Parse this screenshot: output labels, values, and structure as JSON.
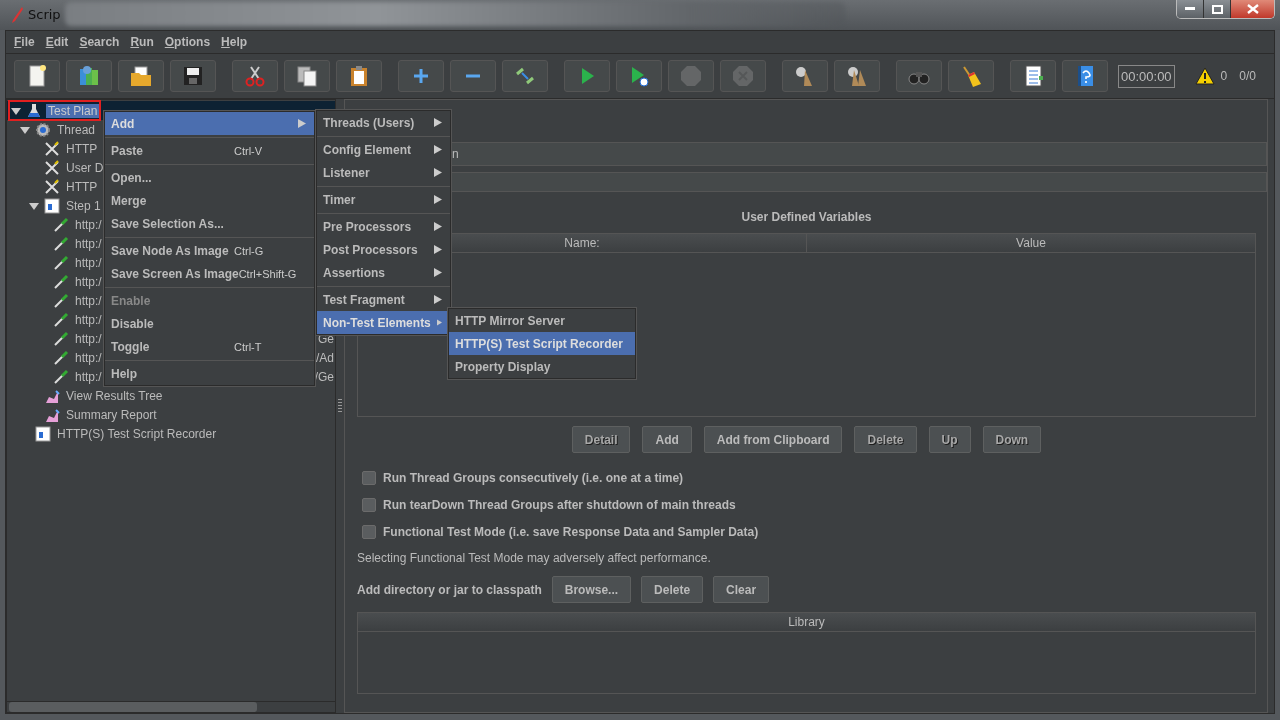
{
  "window": {
    "title": "Scrip"
  },
  "menu_bar": [
    "File",
    "Edit",
    "Search",
    "Run",
    "Options",
    "Help"
  ],
  "toolbar": {
    "groups": [
      [
        {
          "kind": "new",
          "disabled": false
        },
        {
          "kind": "templates",
          "disabled": false
        },
        {
          "kind": "open",
          "disabled": false
        },
        {
          "kind": "save",
          "disabled": false
        }
      ],
      [
        {
          "kind": "cut",
          "disabled": false
        },
        {
          "kind": "copy",
          "disabled": false
        },
        {
          "kind": "paste",
          "disabled": false
        }
      ],
      [
        {
          "kind": "expand",
          "disabled": false
        },
        {
          "kind": "collapse",
          "disabled": false
        },
        {
          "kind": "toggle",
          "disabled": false
        }
      ],
      [
        {
          "kind": "start",
          "disabled": false
        },
        {
          "kind": "start-no-pause",
          "disabled": false
        },
        {
          "kind": "stop",
          "disabled": true
        },
        {
          "kind": "shutdown",
          "disabled": true
        }
      ],
      [
        {
          "kind": "clear",
          "disabled": false
        },
        {
          "kind": "clear-all",
          "disabled": false
        }
      ],
      [
        {
          "kind": "search",
          "disabled": false
        },
        {
          "kind": "reset-search",
          "disabled": false
        }
      ],
      [
        {
          "kind": "functions",
          "disabled": false
        },
        {
          "kind": "help",
          "disabled": false
        }
      ]
    ],
    "timer": "00:00:00",
    "warnings": "0",
    "threads": "0/0"
  },
  "tree": {
    "items": [
      {
        "label": "Test Plan",
        "kind": "test-plan",
        "selected": true,
        "expanded": true,
        "children": [
          {
            "label": "Thread",
            "kind": "thread-group",
            "selected": false,
            "expanded": true,
            "children": [
              {
                "label": "HTTP",
                "kind": "config",
                "selected": false
              },
              {
                "label": "User D",
                "kind": "config",
                "selected": false
              },
              {
                "label": "HTTP",
                "kind": "config",
                "selected": false
              },
              {
                "label": "Step 1",
                "kind": "controller",
                "selected": false,
                "expanded": true,
                "children": [
                  {
                    "label": "http:/",
                    "kind": "sampler",
                    "selected": false
                  },
                  {
                    "label": "http:/",
                    "kind": "sampler",
                    "selected": false
                  },
                  {
                    "label": "http:/",
                    "kind": "sampler",
                    "selected": false
                  },
                  {
                    "label": "http:/",
                    "kind": "sampler",
                    "selected": false
                  },
                  {
                    "label": "http:/",
                    "kind": "sampler",
                    "selected": false
                  },
                  {
                    "label": "http:/",
                    "kind": "sampler",
                    "selected": false
                  },
                  {
                    "label": "http:/",
                    "kind": "sampler",
                    "selected": false,
                    "tail": "Ge"
                  },
                  {
                    "label": "http:/",
                    "kind": "sampler",
                    "selected": false,
                    "tail": "/Ad"
                  },
                  {
                    "label": "http:/",
                    "kind": "sampler",
                    "selected": false,
                    "tail": "/Ge"
                  }
                ]
              },
              {
                "label": "View Results Tree",
                "kind": "listener",
                "selected": false
              },
              {
                "label": "Summary Report",
                "kind": "listener",
                "selected": false
              }
            ]
          },
          {
            "label": "HTTP(S) Test Script Recorder",
            "kind": "recorder",
            "selected": false
          }
        ]
      }
    ]
  },
  "editor": {
    "name_field": {
      "value": "n"
    },
    "variables": {
      "title": "User Defined Variables",
      "columns": [
        "Name:",
        "Value"
      ]
    },
    "table_buttons": [
      {
        "label": "Detail",
        "disabled": true
      },
      {
        "label": "Add",
        "disabled": false
      },
      {
        "label": "Add from Clipboard",
        "disabled": false
      },
      {
        "label": "Delete",
        "disabled": true
      },
      {
        "label": "Up",
        "disabled": true
      },
      {
        "label": "Down",
        "disabled": true
      }
    ],
    "options": [
      {
        "label": "Run Thread Groups consecutively (i.e. one at a time)",
        "checked": false
      },
      {
        "label": "Run tearDown Thread Groups after shutdown of main threads",
        "checked": false
      },
      {
        "label": "Functional Test Mode (i.e. save Response Data and Sampler Data)",
        "checked": false
      }
    ],
    "note": "Selecting Functional Test Mode may adversely affect performance.",
    "classpath": {
      "label": "Add directory or jar to classpath",
      "buttons": [
        {
          "label": "Browse...",
          "disabled": false
        },
        {
          "label": "Delete",
          "disabled": false
        },
        {
          "label": "Clear",
          "disabled": false
        }
      ]
    },
    "library": {
      "columns": [
        "Library"
      ]
    }
  },
  "context_menu": {
    "items": [
      {
        "kind": "item",
        "label": "Add",
        "has_submenu": true,
        "selected": true,
        "disabled": false
      },
      {
        "kind": "separator"
      },
      {
        "kind": "item",
        "label": "Paste",
        "shortcut": "Ctrl-V",
        "has_submenu": false,
        "selected": false,
        "disabled": false
      },
      {
        "kind": "separator"
      },
      {
        "kind": "item",
        "label": "Open...",
        "has_submenu": false,
        "selected": false,
        "disabled": false
      },
      {
        "kind": "item",
        "label": "Merge",
        "has_submenu": false,
        "selected": false,
        "disabled": false
      },
      {
        "kind": "item",
        "label": "Save Selection As...",
        "has_submenu": false,
        "selected": false,
        "disabled": false
      },
      {
        "kind": "separator"
      },
      {
        "kind": "item",
        "label": "Save Node As Image",
        "shortcut": "Ctrl-G",
        "has_submenu": false,
        "selected": false,
        "disabled": false
      },
      {
        "kind": "item",
        "label": "Save Screen As Image",
        "shortcut": "Ctrl+Shift-G",
        "has_submenu": false,
        "selected": false,
        "disabled": false
      },
      {
        "kind": "separator"
      },
      {
        "kind": "item",
        "label": "Enable",
        "has_submenu": false,
        "selected": false,
        "disabled": true
      },
      {
        "kind": "item",
        "label": "Disable",
        "has_submenu": false,
        "selected": false,
        "disabled": false
      },
      {
        "kind": "item",
        "label": "Toggle",
        "shortcut": "Ctrl-T",
        "has_submenu": false,
        "selected": false,
        "disabled": false
      },
      {
        "kind": "separator"
      },
      {
        "kind": "item",
        "label": "Help",
        "has_submenu": false,
        "selected": false,
        "disabled": false
      }
    ]
  },
  "add_submenu": {
    "items": [
      {
        "kind": "item",
        "label": "Threads (Users)",
        "has_submenu": true,
        "selected": false,
        "disabled": false
      },
      {
        "kind": "separator"
      },
      {
        "kind": "item",
        "label": "Config Element",
        "has_submenu": true,
        "selected": false,
        "disabled": false
      },
      {
        "kind": "item",
        "label": "Listener",
        "has_submenu": true,
        "selected": false,
        "disabled": false
      },
      {
        "kind": "separator"
      },
      {
        "kind": "item",
        "label": "Timer",
        "has_submenu": true,
        "selected": false,
        "disabled": false
      },
      {
        "kind": "separator"
      },
      {
        "kind": "item",
        "label": "Pre Processors",
        "has_submenu": true,
        "selected": false,
        "disabled": false
      },
      {
        "kind": "item",
        "label": "Post Processors",
        "has_submenu": true,
        "selected": false,
        "disabled": false
      },
      {
        "kind": "item",
        "label": "Assertions",
        "has_submenu": true,
        "selected": false,
        "disabled": false
      },
      {
        "kind": "separator"
      },
      {
        "kind": "item",
        "label": "Test Fragment",
        "has_submenu": true,
        "selected": false,
        "disabled": false
      },
      {
        "kind": "item",
        "label": "Non-Test Elements",
        "has_submenu": true,
        "selected": true,
        "disabled": false
      }
    ]
  },
  "non_test_submenu": {
    "items": [
      {
        "kind": "item",
        "label": "HTTP Mirror Server",
        "has_submenu": false,
        "selected": false,
        "disabled": false
      },
      {
        "kind": "item",
        "label": "HTTP(S) Test Script Recorder",
        "has_submenu": false,
        "selected": true,
        "disabled": false
      },
      {
        "kind": "item",
        "label": "Property Display",
        "has_submenu": false,
        "selected": false,
        "disabled": false
      }
    ]
  }
}
